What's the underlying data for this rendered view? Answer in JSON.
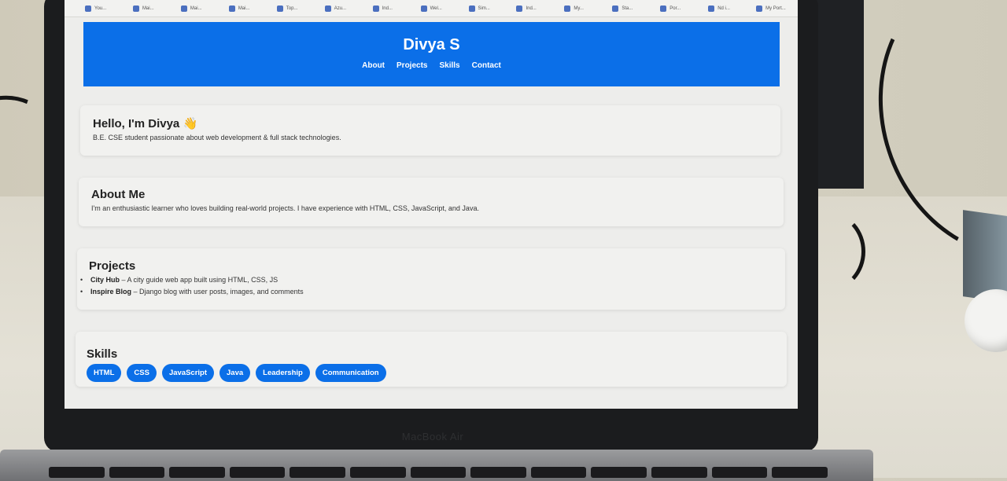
{
  "browser_tabs": [
    {
      "label": "You..."
    },
    {
      "label": "Mai..."
    },
    {
      "label": "Mai..."
    },
    {
      "label": "Mai..."
    },
    {
      "label": "Top..."
    },
    {
      "label": "Azu..."
    },
    {
      "label": "Ind..."
    },
    {
      "label": "Wel..."
    },
    {
      "label": "Sim..."
    },
    {
      "label": "Ind..."
    },
    {
      "label": "My..."
    },
    {
      "label": "Sta..."
    },
    {
      "label": "Por..."
    },
    {
      "label": "Nd i..."
    },
    {
      "label": "My Port..."
    }
  ],
  "header": {
    "title": "Divya S",
    "nav": [
      "About",
      "Projects",
      "Skills",
      "Contact"
    ]
  },
  "hello": {
    "heading": "Hello, I'm Divya 👋",
    "text": "B.E. CSE student passionate about web development & full stack technologies."
  },
  "about": {
    "heading": "About Me",
    "text": "I'm an enthusiastic learner who loves building real-world projects. I have experience with HTML, CSS, JavaScript, and Java."
  },
  "projects": {
    "heading": "Projects",
    "items": [
      {
        "name": "City Hub",
        "desc": " – A city guide web app built using HTML, CSS, JS"
      },
      {
        "name": "Inspire Blog",
        "desc": " – Django blog with user posts, images, and comments"
      }
    ]
  },
  "skills": {
    "heading": "Skills",
    "items": [
      "HTML",
      "CSS",
      "JavaScript",
      "Java",
      "Leadership",
      "Communication"
    ]
  },
  "laptop": {
    "brand": "MacBook Air"
  },
  "colors": {
    "accent": "#0b6fe8"
  }
}
